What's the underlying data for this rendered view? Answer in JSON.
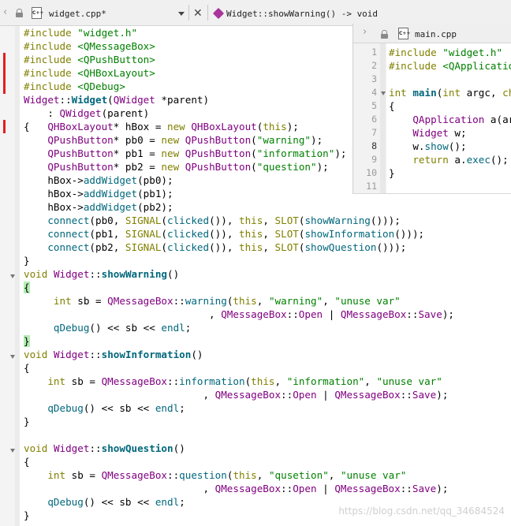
{
  "main_tab": {
    "file": "widget.cpp*",
    "symbol": "Widget::showWarning() -> void",
    "icon": "cpp-file-icon"
  },
  "split_tab": {
    "file": "main.cpp",
    "line_numbers": [
      "1",
      "2",
      "3",
      "4",
      "5",
      "6",
      "7",
      "8",
      "9",
      "10",
      "11"
    ],
    "current_line": "8"
  },
  "watermark": "https://blog.csdn.net/qq_34684524",
  "colors": {
    "keyword": "#808000",
    "string": "#008000",
    "class": "#800080",
    "function": "#00677c",
    "change_marker": "#e02020",
    "brace_highlight": "#b4eeb4"
  }
}
